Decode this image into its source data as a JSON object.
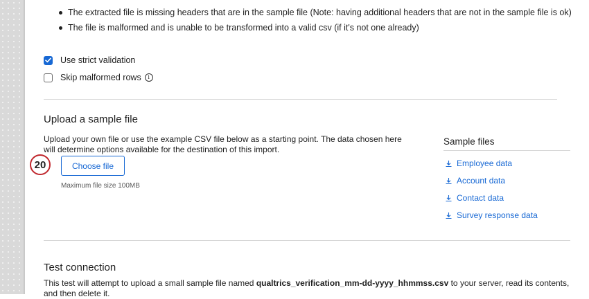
{
  "rules": {
    "bullets": [
      "The extracted file is missing headers that are in the sample file (Note: having additional headers that are not in the sample file is ok)",
      "The file is malformed and is unable to be transformed into a valid csv (if it's not one already)"
    ]
  },
  "options": {
    "strict_validation": {
      "label": "Use strict validation",
      "checked": true
    },
    "skip_malformed": {
      "label": "Skip malformed rows",
      "checked": false,
      "info_icon": "info-icon"
    }
  },
  "upload": {
    "title": "Upload a sample file",
    "description": "Upload your own file or use the example CSV file below as a starting point. The data chosen here will determine options available for the destination of this import.",
    "choose_label": "Choose file",
    "step_badge": "20",
    "max_size": "Maximum file size 100MB"
  },
  "sample_files": {
    "title": "Sample files",
    "links": [
      "Employee data",
      "Account data",
      "Contact data",
      "Survey response data"
    ],
    "icon": "download-icon"
  },
  "test_connection": {
    "title": "Test connection",
    "text_before": "This test will attempt to upload a small sample file named ",
    "filename": "qualtrics_verification_mm-dd-yyyy_hhmmss.csv",
    "text_after": " to your server, read its contents, and then delete it."
  },
  "colors": {
    "accent": "#1768d4",
    "badge_border": "#c0272d"
  }
}
